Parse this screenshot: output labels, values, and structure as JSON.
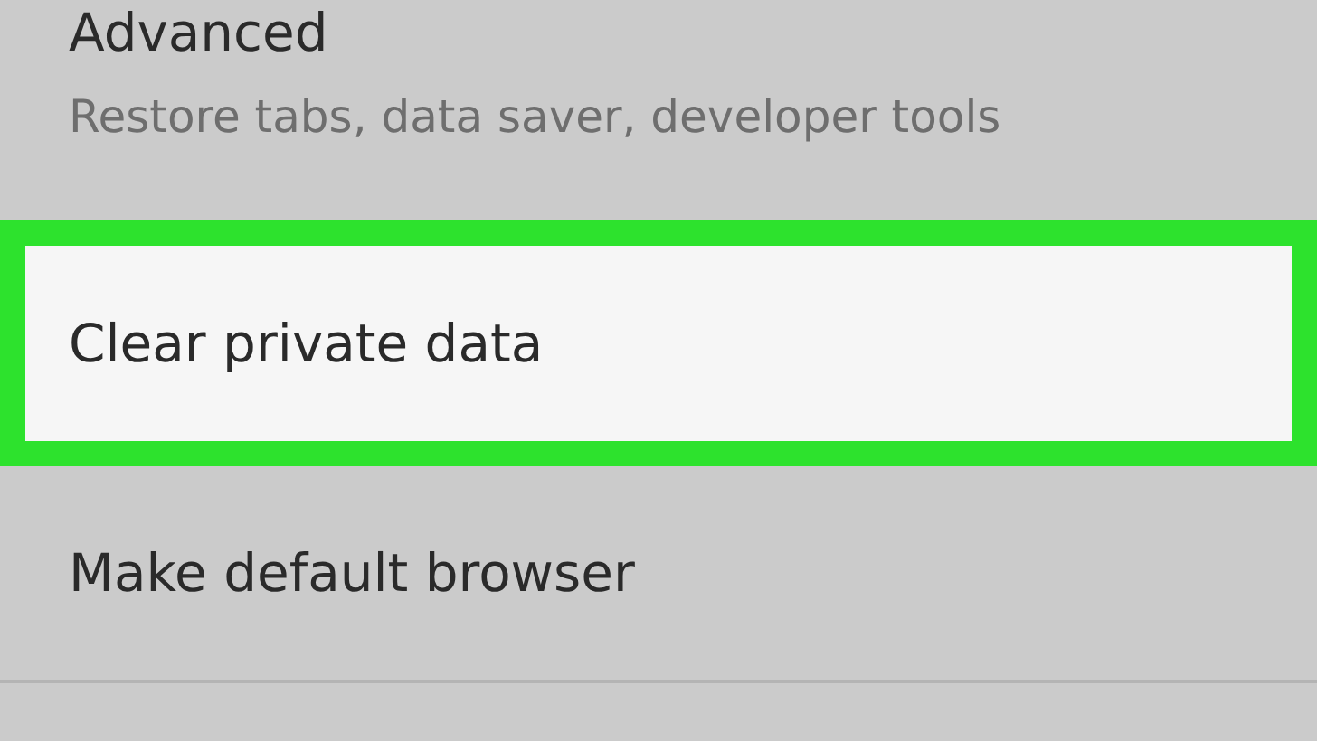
{
  "settings_items": [
    {
      "title": "Advanced",
      "subtitle": "Restore tabs, data saver, developer tools",
      "highlighted": false
    },
    {
      "title": "Clear private data",
      "highlighted": true
    },
    {
      "title": "Make default browser",
      "highlighted": false
    }
  ]
}
